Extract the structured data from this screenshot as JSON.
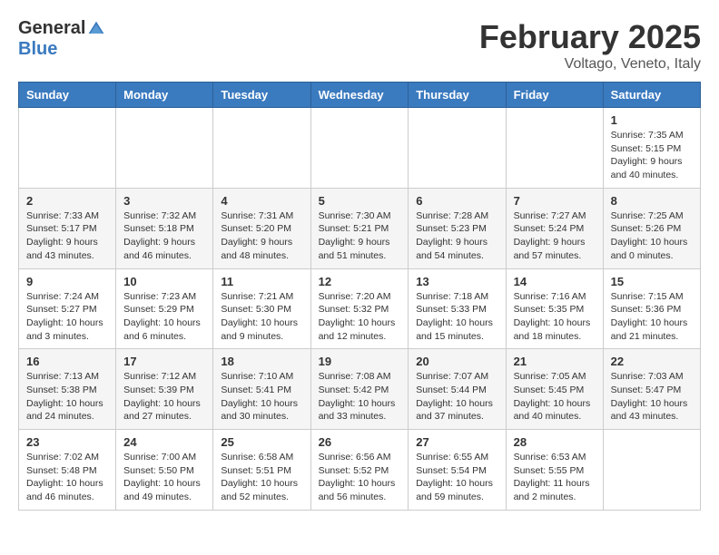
{
  "header": {
    "logo_general": "General",
    "logo_blue": "Blue",
    "title": "February 2025",
    "subtitle": "Voltago, Veneto, Italy"
  },
  "calendar": {
    "weekdays": [
      "Sunday",
      "Monday",
      "Tuesday",
      "Wednesday",
      "Thursday",
      "Friday",
      "Saturday"
    ],
    "weeks": [
      [
        {
          "day": "",
          "info": ""
        },
        {
          "day": "",
          "info": ""
        },
        {
          "day": "",
          "info": ""
        },
        {
          "day": "",
          "info": ""
        },
        {
          "day": "",
          "info": ""
        },
        {
          "day": "",
          "info": ""
        },
        {
          "day": "1",
          "info": "Sunrise: 7:35 AM\nSunset: 5:15 PM\nDaylight: 9 hours and 40 minutes."
        }
      ],
      [
        {
          "day": "2",
          "info": "Sunrise: 7:33 AM\nSunset: 5:17 PM\nDaylight: 9 hours and 43 minutes."
        },
        {
          "day": "3",
          "info": "Sunrise: 7:32 AM\nSunset: 5:18 PM\nDaylight: 9 hours and 46 minutes."
        },
        {
          "day": "4",
          "info": "Sunrise: 7:31 AM\nSunset: 5:20 PM\nDaylight: 9 hours and 48 minutes."
        },
        {
          "day": "5",
          "info": "Sunrise: 7:30 AM\nSunset: 5:21 PM\nDaylight: 9 hours and 51 minutes."
        },
        {
          "day": "6",
          "info": "Sunrise: 7:28 AM\nSunset: 5:23 PM\nDaylight: 9 hours and 54 minutes."
        },
        {
          "day": "7",
          "info": "Sunrise: 7:27 AM\nSunset: 5:24 PM\nDaylight: 9 hours and 57 minutes."
        },
        {
          "day": "8",
          "info": "Sunrise: 7:25 AM\nSunset: 5:26 PM\nDaylight: 10 hours and 0 minutes."
        }
      ],
      [
        {
          "day": "9",
          "info": "Sunrise: 7:24 AM\nSunset: 5:27 PM\nDaylight: 10 hours and 3 minutes."
        },
        {
          "day": "10",
          "info": "Sunrise: 7:23 AM\nSunset: 5:29 PM\nDaylight: 10 hours and 6 minutes."
        },
        {
          "day": "11",
          "info": "Sunrise: 7:21 AM\nSunset: 5:30 PM\nDaylight: 10 hours and 9 minutes."
        },
        {
          "day": "12",
          "info": "Sunrise: 7:20 AM\nSunset: 5:32 PM\nDaylight: 10 hours and 12 minutes."
        },
        {
          "day": "13",
          "info": "Sunrise: 7:18 AM\nSunset: 5:33 PM\nDaylight: 10 hours and 15 minutes."
        },
        {
          "day": "14",
          "info": "Sunrise: 7:16 AM\nSunset: 5:35 PM\nDaylight: 10 hours and 18 minutes."
        },
        {
          "day": "15",
          "info": "Sunrise: 7:15 AM\nSunset: 5:36 PM\nDaylight: 10 hours and 21 minutes."
        }
      ],
      [
        {
          "day": "16",
          "info": "Sunrise: 7:13 AM\nSunset: 5:38 PM\nDaylight: 10 hours and 24 minutes."
        },
        {
          "day": "17",
          "info": "Sunrise: 7:12 AM\nSunset: 5:39 PM\nDaylight: 10 hours and 27 minutes."
        },
        {
          "day": "18",
          "info": "Sunrise: 7:10 AM\nSunset: 5:41 PM\nDaylight: 10 hours and 30 minutes."
        },
        {
          "day": "19",
          "info": "Sunrise: 7:08 AM\nSunset: 5:42 PM\nDaylight: 10 hours and 33 minutes."
        },
        {
          "day": "20",
          "info": "Sunrise: 7:07 AM\nSunset: 5:44 PM\nDaylight: 10 hours and 37 minutes."
        },
        {
          "day": "21",
          "info": "Sunrise: 7:05 AM\nSunset: 5:45 PM\nDaylight: 10 hours and 40 minutes."
        },
        {
          "day": "22",
          "info": "Sunrise: 7:03 AM\nSunset: 5:47 PM\nDaylight: 10 hours and 43 minutes."
        }
      ],
      [
        {
          "day": "23",
          "info": "Sunrise: 7:02 AM\nSunset: 5:48 PM\nDaylight: 10 hours and 46 minutes."
        },
        {
          "day": "24",
          "info": "Sunrise: 7:00 AM\nSunset: 5:50 PM\nDaylight: 10 hours and 49 minutes."
        },
        {
          "day": "25",
          "info": "Sunrise: 6:58 AM\nSunset: 5:51 PM\nDaylight: 10 hours and 52 minutes."
        },
        {
          "day": "26",
          "info": "Sunrise: 6:56 AM\nSunset: 5:52 PM\nDaylight: 10 hours and 56 minutes."
        },
        {
          "day": "27",
          "info": "Sunrise: 6:55 AM\nSunset: 5:54 PM\nDaylight: 10 hours and 59 minutes."
        },
        {
          "day": "28",
          "info": "Sunrise: 6:53 AM\nSunset: 5:55 PM\nDaylight: 11 hours and 2 minutes."
        },
        {
          "day": "",
          "info": ""
        }
      ]
    ]
  }
}
